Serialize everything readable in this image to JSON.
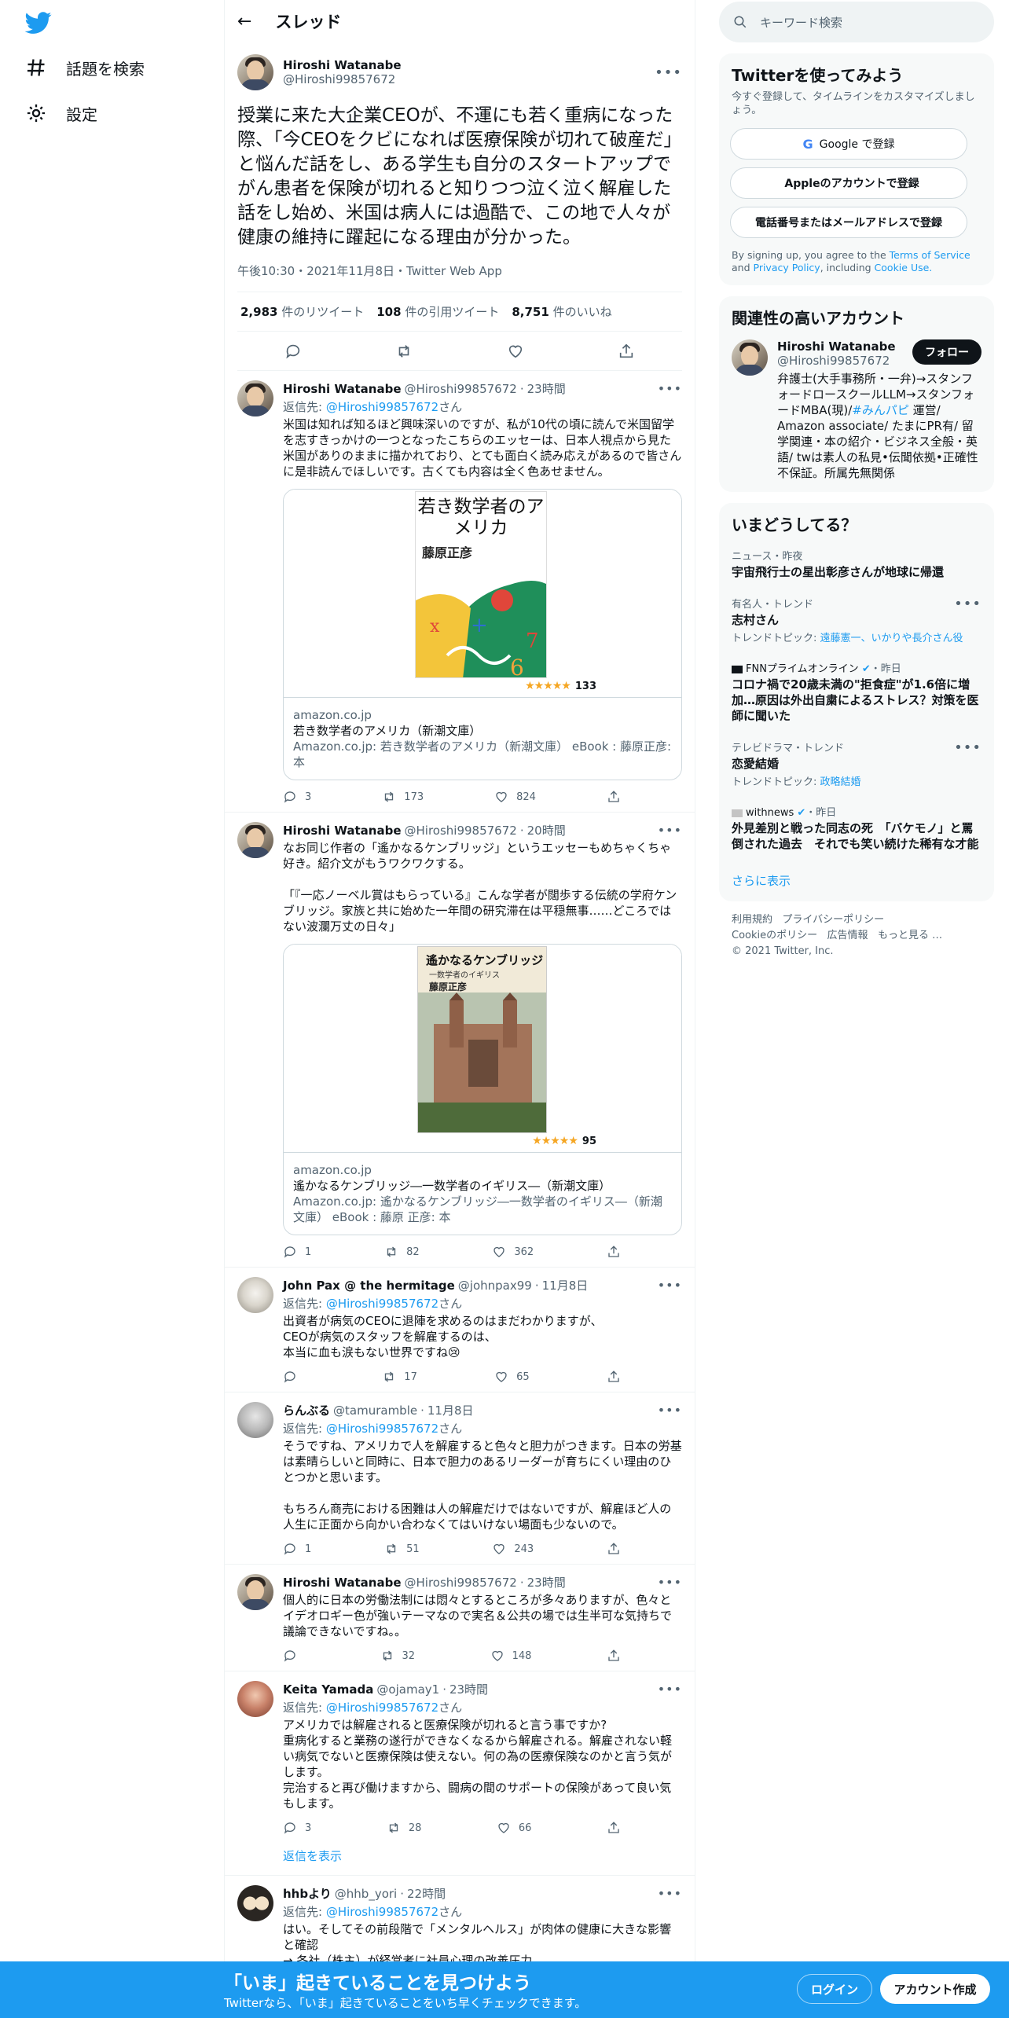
{
  "nav": {
    "explore": "話題を検索",
    "settings": "設定"
  },
  "header": {
    "title": "スレッド"
  },
  "focal": {
    "name": "Hiroshi Watanabe",
    "handle": "@Hiroshi99857672",
    "text": "授業に来た大企業CEOが、不運にも若く重病になった際、「今CEOをクビになれば医療保険が切れて破産だ」と悩んだ話をし、ある学生も自分のスタートアップでがん患者を保険が切れると知りつつ泣く泣く解雇した話をし始め、米国は病人には過酷で、この地で人々が健康の維持に躍起になる理由が分かった。",
    "meta": "午後10:30・2021年11月8日・Twitter Web App",
    "retweets": "2,983",
    "retweets_label": "件のリツイート",
    "quotes": "108",
    "quotes_label": "件の引用ツイート",
    "likes": "8,751",
    "likes_label": "件のいいね"
  },
  "replies": [
    {
      "name": "Hiroshi Watanabe",
      "handle": "@Hiroshi99857672",
      "time": "23時間",
      "reply_to_prefix": "返信先: ",
      "reply_to": "@Hiroshi99857672",
      "reply_to_suffix": "さん",
      "text": "米国は知れば知るほど興味深いのですが、私が10代の頃に読んで米国留学を志すきっかけの一つとなったこちらのエッセーは、日本人視点から見た米国がありのままに描かれており、とても面白く読み応えがあるので皆さんに是非読んでほしいです。古くても内容は全く色あせません。",
      "card": {
        "cover_title": "若き数学者のアメリカ",
        "cover_author": "藤原正彦",
        "rating_count": "133",
        "domain": "amazon.co.jp",
        "title": "若き数学者のアメリカ（新潮文庫）",
        "desc": "Amazon.co.jp: 若き数学者のアメリカ（新潮文庫） eBook : 藤原正彦: 本"
      },
      "replies": "3",
      "retweets": "173",
      "likes": "824"
    },
    {
      "name": "Hiroshi Watanabe",
      "handle": "@Hiroshi99857672",
      "time": "20時間",
      "text": "なお同じ作者の「遙かなるケンブリッジ」というエッセーもめちゃくちゃ好き。紹介文がもうワクワクする。\n\n「『一応ノーベル賞はもらっている』こんな学者が闊歩する伝統の学府ケンブリッジ。家族と共に始めた一年間の研究滞在は平穏無事……どころではない波瀾万丈の日々」",
      "card": {
        "cover_title": "遙かなるケンブリッジ",
        "cover_sub": "一数学者のイギリス",
        "cover_author": "藤原正彦",
        "rating_count": "95",
        "domain": "amazon.co.jp",
        "title": "遙かなるケンブリッジ―一数学者のイギリス―（新潮文庫）",
        "desc": "Amazon.co.jp: 遙かなるケンブリッジ―一数学者のイギリス―（新潮文庫） eBook : 藤原 正彦: 本"
      },
      "replies": "1",
      "retweets": "82",
      "likes": "362"
    },
    {
      "name": "John Pax @ the hermitage",
      "handle": "@johnpax99",
      "time": "11月8日",
      "reply_to_prefix": "返信先: ",
      "reply_to": "@Hiroshi99857672",
      "reply_to_suffix": "さん",
      "text": "出資者が病気のCEOに退陣を求めるのはまだわかりますが、\nCEOが病気のスタッフを解雇するのは、\n本当に血も涙もない世界ですね😢",
      "replies": "",
      "retweets": "17",
      "likes": "65"
    },
    {
      "name": "らんぶる",
      "handle": "@tamuramble",
      "time": "11月8日",
      "reply_to_prefix": "返信先: ",
      "reply_to": "@Hiroshi99857672",
      "reply_to_suffix": "さん",
      "text": "そうですね、アメリカで人を解雇すると色々と胆力がつきます。日本の労基は素晴らしいと同時に、日本で胆力のあるリーダーが育ちにくい理由のひとつかと思います。\n\nもちろん商売における困難は人の解雇だけではないですが、解雇ほど人の人生に正面から向かい合わなくてはいけない場面も少ないので。",
      "replies": "1",
      "retweets": "51",
      "likes": "243"
    },
    {
      "name": "Hiroshi Watanabe",
      "handle": "@Hiroshi99857672",
      "time": "23時間",
      "text": "個人的に日本の労働法制には悶々とするところが多々ありますが、色々とイデオロギー色が強いテーマなので実名＆公共の場では生半可な気持ちで議論できないですね。。",
      "replies": "",
      "retweets": "32",
      "likes": "148"
    },
    {
      "name": "Keita Yamada",
      "handle": "@ojamay1",
      "time": "23時間",
      "reply_to_prefix": "返信先: ",
      "reply_to": "@Hiroshi99857672",
      "reply_to_suffix": "さん",
      "text": "アメリカでは解雇されると医療保険が切れると言う事ですか?\n重病化すると業務の遂行ができなくなるから解雇される。解雇されない軽い病気でないと医療保険は使えない。何の為の医療保険なのかと言う気がします。\n完治すると再び働けますから、闘病の間のサポートの保険があって良い気もします。",
      "replies": "3",
      "retweets": "28",
      "likes": "66"
    },
    {
      "name": "hhbより",
      "handle": "@hhb_yori",
      "time": "22時間",
      "reply_to_prefix": "返信先: ",
      "reply_to": "@Hiroshi99857672",
      "reply_to_suffix": "さん",
      "text": "はい。そしてその前段階で「メンタルヘルス」が肉体の健康に大きな影響と確認\n→ 各社（株主）が経営者に社員心理の改善圧力"
    }
  ],
  "show_replies": "返信を表示",
  "search": {
    "placeholder": "キーワード検索"
  },
  "signup": {
    "title": "Twitterを使ってみよう",
    "sub": "今すぐ登録して、タイムラインをカスタマイズしましょう。",
    "google": "Google で登録",
    "apple": "Appleのアカウントで登録",
    "phone": "電話番号またはメールアドレスで登録",
    "terms_1": "By signing up, you agree to the ",
    "terms_link1": "Terms of Service",
    "terms_2": " and ",
    "terms_link2": "Privacy Policy",
    "terms_3": ", including ",
    "terms_link3": "Cookie Use."
  },
  "related": {
    "title": "関連性の高いアカウント",
    "name": "Hiroshi Watanabe",
    "handle": "@Hiroshi99857672",
    "follow": "フォロー",
    "bio_1": "弁護士(大手事務所・一弁)→スタンフォードロースクールLLM→スタンフォードMBA(現)/",
    "bio_tag": "#みんパピ",
    "bio_2": " 運営/ Amazon associate/ たまにPR有/ 留学関連・本の紹介・ビジネス全般・英語/ twは素人の私見•伝聞依拠•正確性不保証。所属先無関係"
  },
  "trends": {
    "title": "いまどうしてる？",
    "items": [
      {
        "ctx": "ニュース・昨夜",
        "title": "宇宙飛行士の星出彰彦さんが地球に帰還"
      },
      {
        "ctx": "有名人・トレンド",
        "title": "志村さん",
        "sub_label": "トレンドトピック: ",
        "sub": "遠藤憲一、いかりや長介さん役"
      },
      {
        "ctx_source": "FNNプライムオンライン",
        "ctx_time": "・昨日",
        "title": "コロナ禍で20歳未満の\"拒食症\"が1.6倍に増加…原因は外出自粛によるストレス？対策を医師に聞いた"
      },
      {
        "ctx": "テレビドラマ・トレンド",
        "title": "恋愛結婚",
        "sub_label": "トレンドトピック: ",
        "sub": "政略結婚"
      },
      {
        "ctx_source": "withnews",
        "ctx_time": "・昨日",
        "title": "外見差別と戦った同志の死　「バケモノ」と罵倒された過去　それでも笑い続けた稀有な才能"
      }
    ],
    "more": "さらに表示"
  },
  "footer": {
    "l1": "利用規約",
    "l2": "プライバシーポリシー",
    "l3": "Cookieのポリシー",
    "l4": "広告情報",
    "l5": "もっと見る …",
    "copy": "© 2021 Twitter, Inc."
  },
  "banner": {
    "headline": "「いま」起きていることを見つけよう",
    "sub": "Twitterなら、「いま」起きていることをいち早くチェックできます。",
    "login": "ログイン",
    "signup": "アカウント作成"
  },
  "colors": {
    "accent": "#1d9bf0",
    "text": "#0f1419",
    "muted": "#536471"
  }
}
